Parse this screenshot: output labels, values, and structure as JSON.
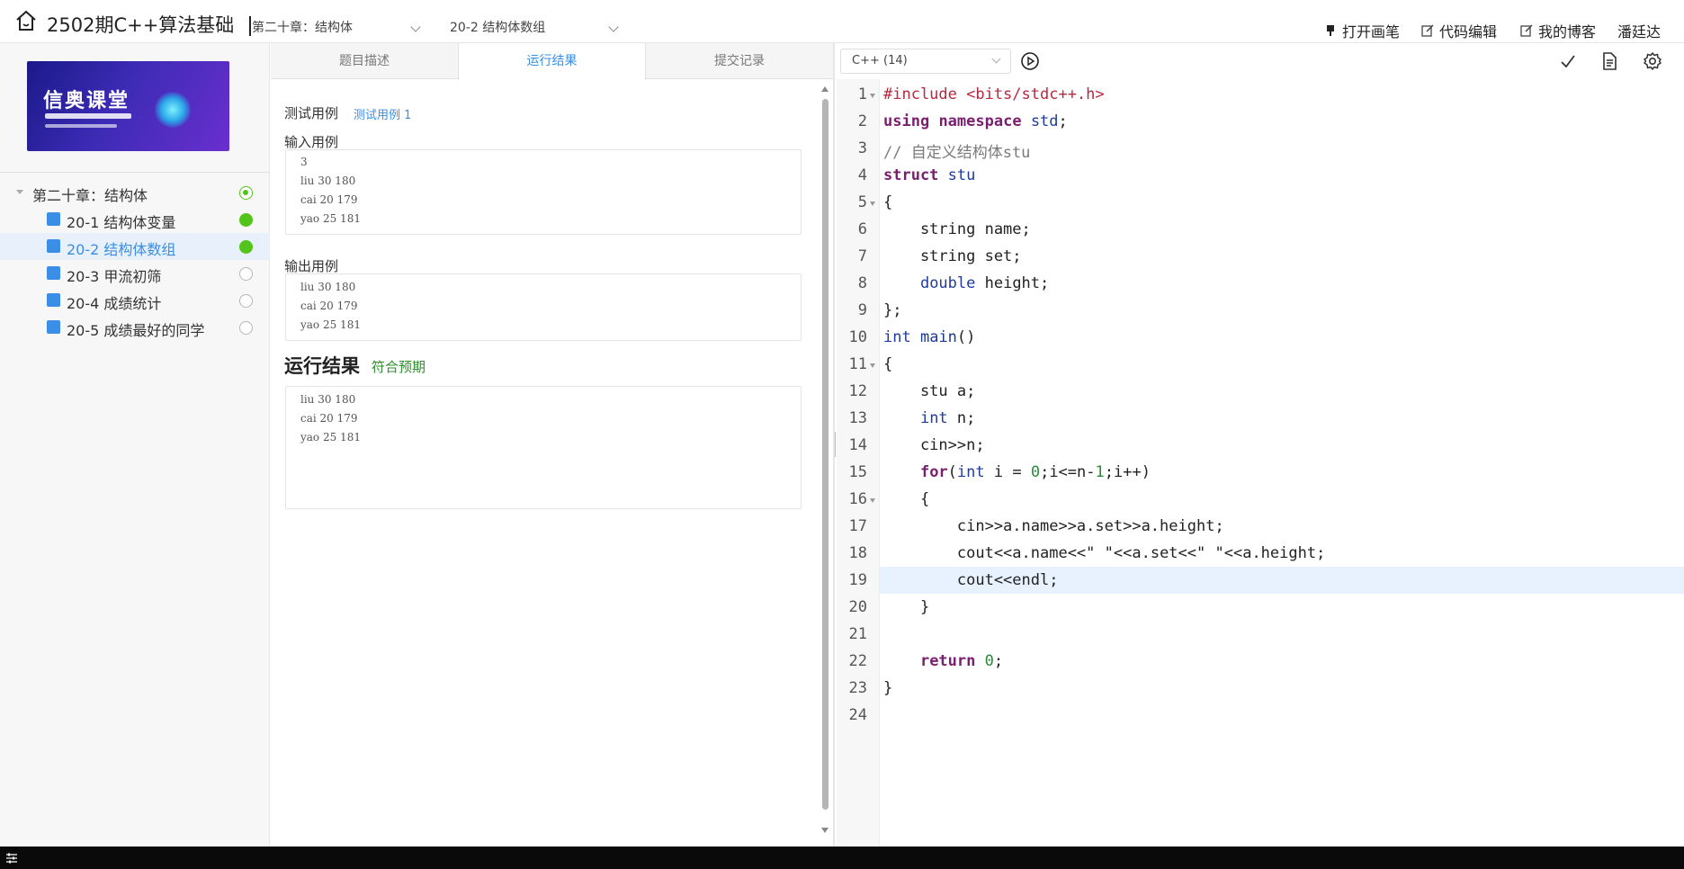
{
  "header": {
    "course_title": "2502期C++算法基础",
    "chapter_select": "第二十章：结构体",
    "lesson_select": "20-2 结构体数组",
    "actions": [
      "打开画笔",
      "代码编辑",
      "我的博客"
    ],
    "user_name": "潘廷达"
  },
  "sidebar": {
    "banner_text": "信奥课堂",
    "chapter": "第二十章：结构体",
    "lessons": [
      {
        "label": "20-1 结构体变量",
        "status": "done"
      },
      {
        "label": "20-2 结构体数组",
        "status": "done"
      },
      {
        "label": "20-3 甲流初筛",
        "status": "pending"
      },
      {
        "label": "20-4 成绩统计",
        "status": "pending"
      },
      {
        "label": "20-5 成绩最好的同学",
        "status": "pending"
      }
    ]
  },
  "tabs": [
    "题目描述",
    "运行结果",
    "提交记录"
  ],
  "result": {
    "test_case_label": "测试用例",
    "test_case_link": "测试用例 1",
    "input_label": "输入用例",
    "input_lines": [
      "3",
      "liu 30 180",
      "cai 20 179",
      "yao 25 181"
    ],
    "output_label": "输出用例",
    "output_lines": [
      "liu 30 180",
      "cai 20 179",
      "yao 25 181"
    ],
    "run_title": "运行结果",
    "run_status": "符合预期",
    "run_lines": [
      "liu 30 180",
      "cai 20 179",
      "yao 25 181"
    ]
  },
  "editor": {
    "language": "C++ (14)",
    "line_numbers": [
      "1",
      "2",
      "3",
      "4",
      "5",
      "6",
      "7",
      "8",
      "9",
      "10",
      "11",
      "12",
      "13",
      "14",
      "15",
      "16",
      "17",
      "18",
      "19",
      "20",
      "21",
      "22",
      "23",
      "24"
    ],
    "code_lines": [
      "#include <bits/stdc++.h>",
      "using namespace std;",
      "// 自定义结构体stu",
      "struct stu",
      "{",
      "    string name;",
      "    string set;",
      "    double height;",
      "};",
      "int main()",
      "{",
      "    stu a;",
      "    int n;",
      "    cin>>n;",
      "    for(int i = 0;i<=n-1;i++)",
      "    {",
      "        cin>>a.name>>a.set>>a.height;",
      "        cout<<a.name<<\" \"<<a.set<<\" \"<<a.height;",
      "        cout<<endl;",
      "    }",
      "",
      "    return 0;",
      "}",
      ""
    ]
  }
}
